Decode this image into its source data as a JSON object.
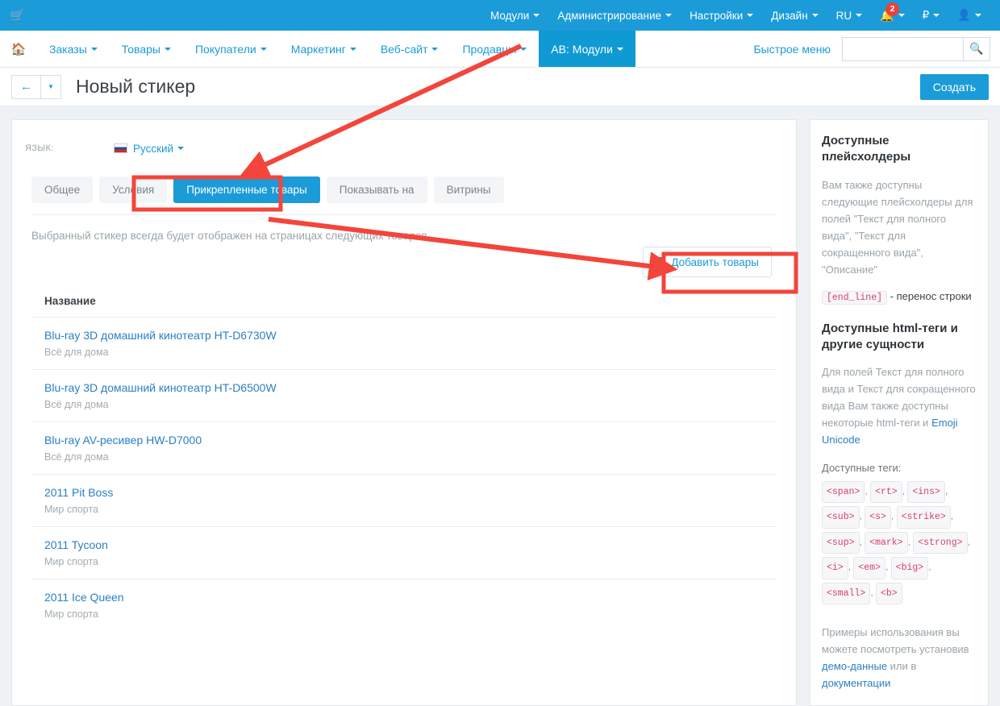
{
  "colors": {
    "brand": "#1b9bd8",
    "accent_red": "#f3453b",
    "link": "#2a7fc4",
    "badge": "#e8433a"
  },
  "topbar": {
    "cart_icon": "cart-icon",
    "items": [
      {
        "label": "Модули",
        "caret": true
      },
      {
        "label": "Администрирование",
        "caret": true
      },
      {
        "label": "Настройки",
        "caret": true
      },
      {
        "label": "Дизайн",
        "caret": true
      },
      {
        "label": "RU",
        "caret": true
      }
    ],
    "notifications_count": "2",
    "currency": "₽",
    "user_icon": "user-icon"
  },
  "navbar": {
    "home_icon": "home-icon",
    "items": [
      {
        "label": "Заказы",
        "active": false
      },
      {
        "label": "Товары",
        "active": false
      },
      {
        "label": "Покупатели",
        "active": false
      },
      {
        "label": "Маркетинг",
        "active": false
      },
      {
        "label": "Веб-сайт",
        "active": false
      },
      {
        "label": "Продавцы",
        "active": false
      },
      {
        "label": "AB: Модули",
        "active": true
      }
    ],
    "quick_menu": "Быстрое меню",
    "search_value": "",
    "search_placeholder": "",
    "search_icon": "search-icon"
  },
  "titlebar": {
    "back_icon": "arrow-left-icon",
    "dropdown_icon": "chevron-down-icon",
    "title": "Новый стикер",
    "create_label": "Создать"
  },
  "form": {
    "language_label": "Язык:",
    "language_value": "Русский",
    "flag_icon": "flag-ru-icon",
    "tabs": [
      {
        "label": "Общее",
        "active": false
      },
      {
        "label": "Условия",
        "active": false
      },
      {
        "label": "Прикрепленные товары",
        "active": true
      },
      {
        "label": "Показывать на",
        "active": false
      },
      {
        "label": "Витрины",
        "active": false
      }
    ],
    "hint": "Выбранный стикер всегда будет отображен на страницах следующих товаров",
    "add_products_label": "Добавить товары",
    "add_products_icon": "plus-icon"
  },
  "table": {
    "header": "Название",
    "rows": [
      {
        "name": "Blu-ray 3D домашний кинотеатр HT-D6730W",
        "category": "Всё для дома"
      },
      {
        "name": "Blu-ray 3D домашний кинотеатр HT-D6500W",
        "category": "Всё для дома"
      },
      {
        "name": "Blu-ray AV-ресивер HW-D7000",
        "category": "Всё для дома"
      },
      {
        "name": "2011 Pit Boss",
        "category": "Мир спорта"
      },
      {
        "name": "2011 Tycoon",
        "category": "Мир спорта"
      },
      {
        "name": "2011 Ice Queen",
        "category": "Мир спорта"
      }
    ]
  },
  "sidebar": {
    "placeholders_title": "Доступные плейсхолдеры",
    "placeholders_text": "Вам также доступны следующие плейсхолдеры для полей \"Текст для полного вида\", \"Текст для сокращенного вида\", \"Описание\"",
    "end_line_code": "[end_line]",
    "end_line_desc": " - перенос строки",
    "html_title_a": "Доступные ",
    "html_title_b": "html",
    "html_title_c": "-теги и другие сущности",
    "html_text": "Для полей Текст для полного вида и Текст для сокращенного вида Вам также доступны некоторые html-теги и ",
    "emoji_link": "Emoji Unicode",
    "tags_label": "Доступные теги:",
    "tags": [
      "<span>",
      "<rt>",
      "<ins>",
      "<sub>",
      "<s>",
      "<strike>",
      "<sup>",
      "<mark>",
      "<strong>",
      "<i>",
      "<em>",
      "<big>",
      "<small>",
      "<b>"
    ],
    "examples_text_a": "Примеры использования вы можете посмотреть установив ",
    "demo_link": "демо-данные",
    "examples_text_b": " или в ",
    "docs_link": "документации"
  },
  "annotations": {
    "arrow1_name": "arrow-to-attached-products-tab",
    "arrow2_name": "arrow-to-add-products-button",
    "box1_name": "highlight-box-attached-products-tab",
    "box2_name": "highlight-box-add-products-button"
  }
}
